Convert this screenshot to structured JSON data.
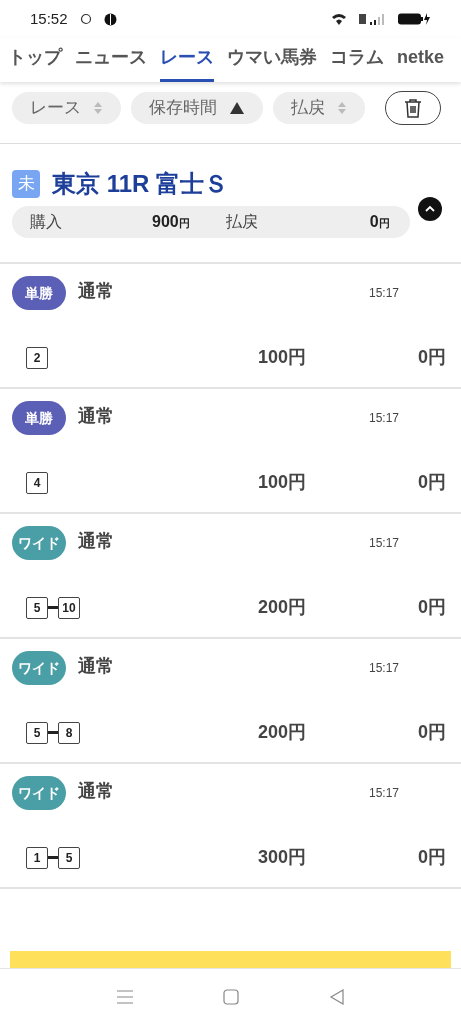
{
  "status_bar": {
    "time": "15:52"
  },
  "tabs": [
    {
      "label": "トップ",
      "selected": false
    },
    {
      "label": "ニュース",
      "selected": false
    },
    {
      "label": "レース",
      "selected": true
    },
    {
      "label": "ウマい馬券",
      "selected": false
    },
    {
      "label": "コラム",
      "selected": false
    },
    {
      "label": "netke",
      "selected": false
    }
  ],
  "sort_chips": [
    {
      "label": "レース",
      "kind": "both"
    },
    {
      "label": "保存時間",
      "kind": "up"
    },
    {
      "label": "払戻",
      "kind": "both"
    }
  ],
  "race": {
    "status": "未",
    "title": "東京 11R 富士Ｓ",
    "expanded": true,
    "purchase_label": "購入",
    "purchase": "900",
    "payout_label": "払戻",
    "payout": "0",
    "purchase_yen": "円",
    "payout_yen": "円"
  },
  "bets": [
    {
      "type": "単勝",
      "color": "#5b5fb5",
      "mode": "通常",
      "time": "15:17",
      "horses": [
        "2"
      ],
      "amount": "100円",
      "payout": "0円"
    },
    {
      "type": "単勝",
      "color": "#5b5fb5",
      "mode": "通常",
      "time": "15:17",
      "horses": [
        "4"
      ],
      "amount": "100円",
      "payout": "0円"
    },
    {
      "type": "ワイド",
      "color": "#4a9ea6",
      "mode": "通常",
      "time": "15:17",
      "horses": [
        "5",
        "10"
      ],
      "amount": "200円",
      "payout": "0円"
    },
    {
      "type": "ワイド",
      "color": "#4a9ea6",
      "mode": "通常",
      "time": "15:17",
      "horses": [
        "5",
        "8"
      ],
      "amount": "200円",
      "payout": "0円"
    },
    {
      "type": "ワイド",
      "color": "#4a9ea6",
      "mode": "通常",
      "time": "15:17",
      "horses": [
        "1",
        "5"
      ],
      "amount": "300円",
      "payout": "0円"
    }
  ]
}
